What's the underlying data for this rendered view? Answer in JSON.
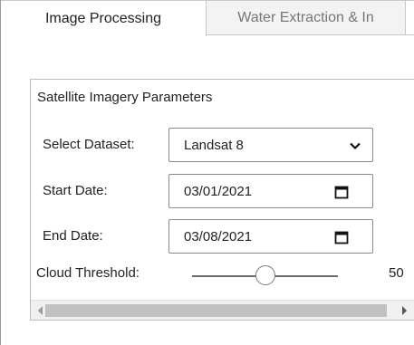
{
  "tabs": [
    {
      "label": "Image Processing",
      "active": true
    },
    {
      "label": "Water Extraction & In",
      "active": false
    }
  ],
  "panel": {
    "title": "Satellite Imagery Parameters",
    "dataset": {
      "label": "Select Dataset:",
      "value": "Landsat 8"
    },
    "start_date": {
      "label": "Start Date:",
      "value": "03/01/2021",
      "icon": "calendar-icon"
    },
    "end_date": {
      "label": "End Date:",
      "value": "03/08/2021",
      "icon": "calendar-icon"
    },
    "cloud_threshold": {
      "label": "Cloud Threshold:",
      "value": "50",
      "level": 50
    }
  },
  "colors": {
    "border": "#8a8a8a",
    "track": "#6d6d6d",
    "scroll_thumb": "#c1c1c1"
  }
}
